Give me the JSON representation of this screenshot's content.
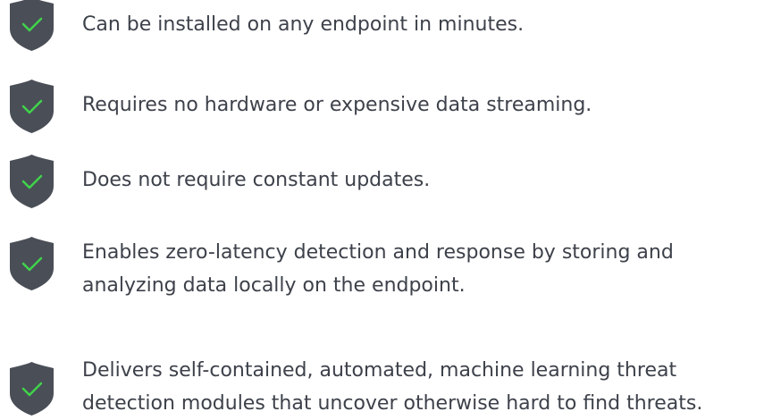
{
  "features": [
    {
      "icon": "shield-check-icon",
      "lines": [
        "Can be installed on any endpoint in minutes."
      ]
    },
    {
      "icon": "shield-check-icon",
      "lines": [
        "Requires no hardware or expensive data streaming."
      ]
    },
    {
      "icon": "shield-check-icon",
      "lines": [
        "Does not require constant updates."
      ]
    },
    {
      "icon": "shield-check-icon",
      "lines": [
        "Enables zero-latency detection and response by storing and",
        "analyzing data locally on the endpoint."
      ]
    },
    {
      "icon": "shield-check-icon",
      "lines": [
        "Delivers self-contained, automated, machine learning threat",
        "detection modules that uncover otherwise hard to find threats."
      ]
    }
  ],
  "colors": {
    "shield": "#4a4e57",
    "check": "#3fd44a",
    "text": "#3d414a"
  }
}
